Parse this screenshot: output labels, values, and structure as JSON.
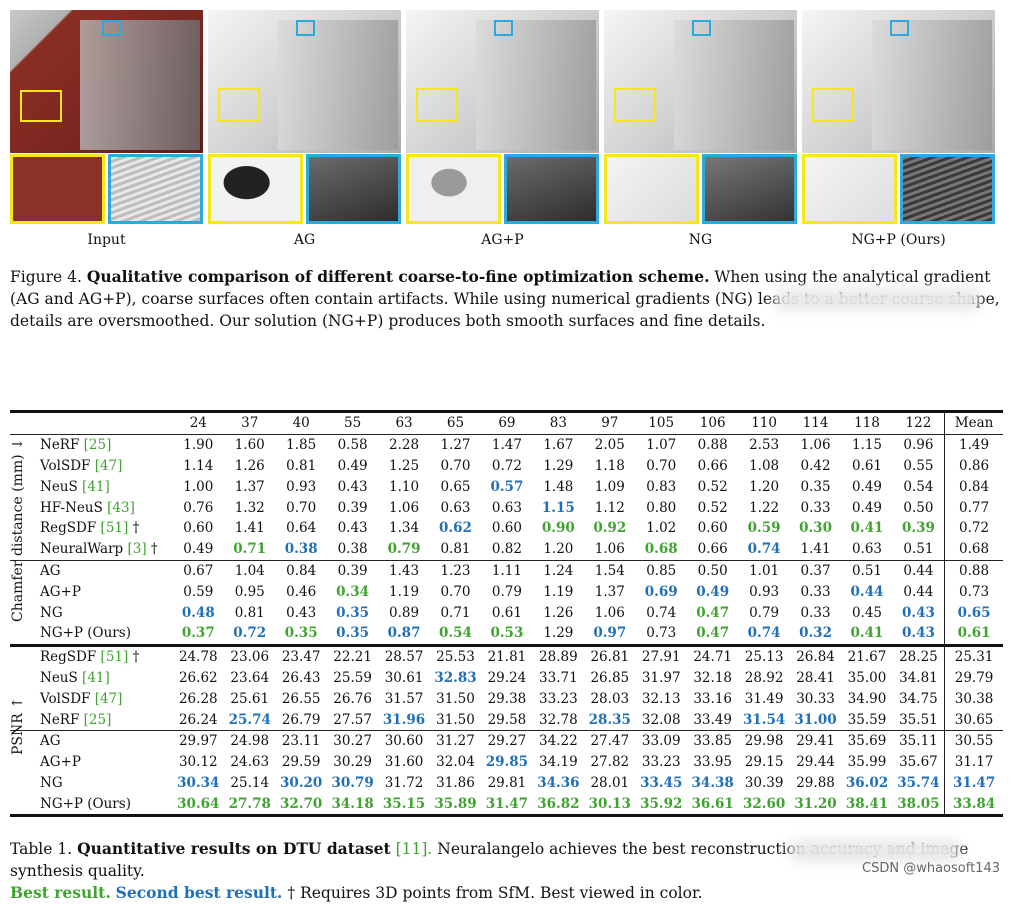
{
  "figure": {
    "columns": [
      {
        "label": "Input"
      },
      {
        "label": "AG"
      },
      {
        "label": "AG+P"
      },
      {
        "label": "NG"
      },
      {
        "label": "NG+P (Ours)"
      }
    ],
    "caption_prefix": "Figure 4.",
    "caption_bold": "Qualitative comparison of different coarse-to-fine optimization scheme.",
    "caption_rest": "When using the analytical gradient (AG and AG+P), coarse surfaces often contain artifacts. While using numerical gradients (NG) leads to a better coarse shape, details are oversmoothed. Our solution (NG+P) produces both smooth surfaces and fine details."
  },
  "table": {
    "scans": [
      "24",
      "37",
      "40",
      "55",
      "63",
      "65",
      "69",
      "83",
      "97",
      "105",
      "106",
      "110",
      "114",
      "118",
      "122"
    ],
    "mean_label": "Mean",
    "chamfer_label": "Chamfer distance (mm) ↓",
    "psnr_label": "PSNR ↑",
    "chamfer_rows": [
      {
        "name": "NeRF",
        "ref": "[25]",
        "dag": "",
        "vals": [
          "1.90",
          "1.60",
          "1.85",
          "0.58",
          "2.28",
          "1.27",
          "1.47",
          "1.67",
          "2.05",
          "1.07",
          "0.88",
          "2.53",
          "1.06",
          "1.15",
          "0.96"
        ],
        "mean": "1.49",
        "style": {}
      },
      {
        "name": "VolSDF",
        "ref": "[47]",
        "dag": "",
        "vals": [
          "1.14",
          "1.26",
          "0.81",
          "0.49",
          "1.25",
          "0.70",
          "0.72",
          "1.29",
          "1.18",
          "0.70",
          "0.66",
          "1.08",
          "0.42",
          "0.61",
          "0.55"
        ],
        "mean": "0.86",
        "style": {}
      },
      {
        "name": "NeuS",
        "ref": "[41]",
        "dag": "",
        "vals": [
          "1.00",
          "1.37",
          "0.93",
          "0.43",
          "1.10",
          "0.65",
          "0.57",
          "1.48",
          "1.09",
          "0.83",
          "0.52",
          "1.20",
          "0.35",
          "0.49",
          "0.54"
        ],
        "mean": "0.84",
        "style": {
          "6": "second"
        }
      },
      {
        "name": "HF-NeuS",
        "ref": "[43]",
        "dag": "",
        "vals": [
          "0.76",
          "1.32",
          "0.70",
          "0.39",
          "1.06",
          "0.63",
          "0.63",
          "1.15",
          "1.12",
          "0.80",
          "0.52",
          "1.22",
          "0.33",
          "0.49",
          "0.50"
        ],
        "mean": "0.77",
        "style": {
          "7": "second"
        }
      },
      {
        "name": "RegSDF",
        "ref": "[51]",
        "dag": "†",
        "vals": [
          "0.60",
          "1.41",
          "0.64",
          "0.43",
          "1.34",
          "0.62",
          "0.60",
          "0.90",
          "0.92",
          "1.02",
          "0.60",
          "0.59",
          "0.30",
          "0.41",
          "0.39"
        ],
        "mean": "0.72",
        "style": {
          "5": "second",
          "7": "best",
          "8": "best",
          "11": "best",
          "12": "best",
          "13": "best",
          "14": "best"
        }
      },
      {
        "name": "NeuralWarp",
        "ref": "[3]",
        "dag": "†",
        "vals": [
          "0.49",
          "0.71",
          "0.38",
          "0.38",
          "0.79",
          "0.81",
          "0.82",
          "1.20",
          "1.06",
          "0.68",
          "0.66",
          "0.74",
          "1.41",
          "0.63",
          "0.51"
        ],
        "mean": "0.68",
        "style": {
          "1": "best",
          "2": "second",
          "4": "best",
          "9": "best",
          "11": "second"
        }
      },
      {
        "name": "AG",
        "ref": "",
        "dag": "",
        "vals": [
          "0.67",
          "1.04",
          "0.84",
          "0.39",
          "1.43",
          "1.23",
          "1.11",
          "1.24",
          "1.54",
          "0.85",
          "0.50",
          "1.01",
          "0.37",
          "0.51",
          "0.44"
        ],
        "mean": "0.88",
        "style": {}
      },
      {
        "name": "AG+P",
        "ref": "",
        "dag": "",
        "vals": [
          "0.59",
          "0.95",
          "0.46",
          "0.34",
          "1.19",
          "0.70",
          "0.79",
          "1.19",
          "1.37",
          "0.69",
          "0.49",
          "0.93",
          "0.33",
          "0.44",
          "0.44"
        ],
        "mean": "0.73",
        "style": {
          "3": "best",
          "9": "second",
          "10": "second",
          "13": "second"
        }
      },
      {
        "name": "NG",
        "ref": "",
        "dag": "",
        "vals": [
          "0.48",
          "0.81",
          "0.43",
          "0.35",
          "0.89",
          "0.71",
          "0.61",
          "1.26",
          "1.06",
          "0.74",
          "0.47",
          "0.79",
          "0.33",
          "0.45",
          "0.43"
        ],
        "mean": "0.65",
        "style": {
          "0": "second",
          "3": "second",
          "10": "best",
          "14": "second",
          "mean": "second"
        }
      },
      {
        "name": "NG+P (Ours)",
        "ref": "",
        "dag": "",
        "vals": [
          "0.37",
          "0.72",
          "0.35",
          "0.35",
          "0.87",
          "0.54",
          "0.53",
          "1.29",
          "0.97",
          "0.73",
          "0.47",
          "0.74",
          "0.32",
          "0.41",
          "0.43"
        ],
        "mean": "0.61",
        "style": {
          "0": "best",
          "1": "second",
          "2": "best",
          "3": "second",
          "4": "second",
          "5": "best",
          "6": "best",
          "8": "second",
          "10": "best",
          "11": "second",
          "12": "second",
          "13": "best",
          "14": "second",
          "mean": "best"
        }
      }
    ],
    "psnr_rows": [
      {
        "name": "RegSDF",
        "ref": "[51]",
        "dag": "†",
        "vals": [
          "24.78",
          "23.06",
          "23.47",
          "22.21",
          "28.57",
          "25.53",
          "21.81",
          "28.89",
          "26.81",
          "27.91",
          "24.71",
          "25.13",
          "26.84",
          "21.67",
          "28.25"
        ],
        "mean": "25.31",
        "style": {}
      },
      {
        "name": "NeuS",
        "ref": "[41]",
        "dag": "",
        "vals": [
          "26.62",
          "23.64",
          "26.43",
          "25.59",
          "30.61",
          "32.83",
          "29.24",
          "33.71",
          "26.85",
          "31.97",
          "32.18",
          "28.92",
          "28.41",
          "35.00",
          "34.81"
        ],
        "mean": "29.79",
        "style": {
          "5": "second"
        }
      },
      {
        "name": "VolSDF",
        "ref": "[47]",
        "dag": "",
        "vals": [
          "26.28",
          "25.61",
          "26.55",
          "26.76",
          "31.57",
          "31.50",
          "29.38",
          "33.23",
          "28.03",
          "32.13",
          "33.16",
          "31.49",
          "30.33",
          "34.90",
          "34.75"
        ],
        "mean": "30.38",
        "style": {}
      },
      {
        "name": "NeRF",
        "ref": "[25]",
        "dag": "",
        "vals": [
          "26.24",
          "25.74",
          "26.79",
          "27.57",
          "31.96",
          "31.50",
          "29.58",
          "32.78",
          "28.35",
          "32.08",
          "33.49",
          "31.54",
          "31.00",
          "35.59",
          "35.51"
        ],
        "mean": "30.65",
        "style": {
          "1": "second",
          "4": "second",
          "8": "second",
          "11": "second",
          "12": "second"
        }
      },
      {
        "name": "AG",
        "ref": "",
        "dag": "",
        "vals": [
          "29.97",
          "24.98",
          "23.11",
          "30.27",
          "30.60",
          "31.27",
          "29.27",
          "34.22",
          "27.47",
          "33.09",
          "33.85",
          "29.98",
          "29.41",
          "35.69",
          "35.11"
        ],
        "mean": "30.55",
        "style": {}
      },
      {
        "name": "AG+P",
        "ref": "",
        "dag": "",
        "vals": [
          "30.12",
          "24.63",
          "29.59",
          "30.29",
          "31.60",
          "32.04",
          "29.85",
          "34.19",
          "27.82",
          "33.23",
          "33.95",
          "29.15",
          "29.44",
          "35.99",
          "35.67"
        ],
        "mean": "31.17",
        "style": {
          "6": "second"
        }
      },
      {
        "name": "NG",
        "ref": "",
        "dag": "",
        "vals": [
          "30.34",
          "25.14",
          "30.20",
          "30.79",
          "31.72",
          "31.86",
          "29.81",
          "34.36",
          "28.01",
          "33.45",
          "34.38",
          "30.39",
          "29.88",
          "36.02",
          "35.74"
        ],
        "mean": "31.47",
        "style": {
          "0": "second",
          "2": "second",
          "3": "second",
          "7": "second",
          "9": "second",
          "10": "second",
          "13": "second",
          "14": "second",
          "mean": "second"
        }
      },
      {
        "name": "NG+P (Ours)",
        "ref": "",
        "dag": "",
        "vals": [
          "30.64",
          "27.78",
          "32.70",
          "34.18",
          "35.15",
          "35.89",
          "31.47",
          "36.82",
          "30.13",
          "35.92",
          "36.61",
          "32.60",
          "31.20",
          "38.41",
          "38.05"
        ],
        "mean": "33.84",
        "style": {
          "0": "best",
          "1": "best",
          "2": "best",
          "3": "best",
          "4": "best",
          "5": "best",
          "6": "best",
          "7": "best",
          "8": "best",
          "9": "best",
          "10": "best",
          "11": "best",
          "12": "best",
          "13": "best",
          "14": "best",
          "mean": "best"
        }
      }
    ],
    "caption_prefix": "Table 1.",
    "caption_bold": "Quantitative results on DTU dataset",
    "caption_ref": "[11].",
    "caption_rest": "Neuralangelo achieves the best reconstruction accuracy and image synthesis quality.",
    "legend_best": "Best result.",
    "legend_second": "Second best result.",
    "caption_tail": "† Requires 3D points from SfM. Best viewed in color."
  },
  "watermark": "CSDN @whaosoft143",
  "colors": {
    "best": "#3fa32f",
    "second": "#1f6fb9",
    "yellow": "#f6e817",
    "blue": "#2ea9e0"
  }
}
